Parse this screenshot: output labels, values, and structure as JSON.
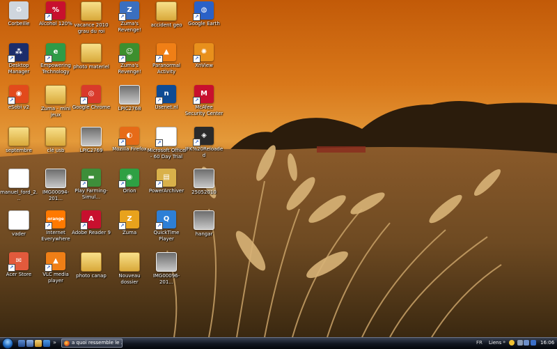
{
  "desktop": {
    "icons": [
      {
        "label": "Corbeille",
        "icon": "recycle-bin-icon",
        "shortcut": false,
        "color": "#cfd6de",
        "glyph": "♻",
        "kind": "default"
      },
      {
        "label": "Alcohol 120%",
        "icon": "alcohol-120-icon",
        "shortcut": true,
        "color": "#c8102e",
        "glyph": "%",
        "kind": "default"
      },
      {
        "label": "vacance 2010 grau du roi",
        "icon": "folder-icon",
        "shortcut": false,
        "color": "#e8c25a",
        "glyph": "",
        "kind": "folder"
      },
      {
        "label": "Zuma's Revenge!",
        "icon": "zuma-revenge-icon",
        "shortcut": true,
        "color": "#3b6fbf",
        "glyph": "Z",
        "kind": "default"
      },
      {
        "label": "accident geo",
        "icon": "folder-icon",
        "shortcut": false,
        "color": "#e8c25a",
        "glyph": "",
        "kind": "folder"
      },
      {
        "label": "Google Earth",
        "icon": "google-earth-icon",
        "shortcut": true,
        "color": "#2a61c7",
        "glyph": "◍",
        "kind": "round"
      },
      {
        "label": "Desktop Manager",
        "icon": "blackberry-desktop-manager-icon",
        "shortcut": true,
        "color": "#1b2d6b",
        "glyph": "⁂",
        "kind": "default"
      },
      {
        "label": "Empowering Technology",
        "icon": "empowering-technology-icon",
        "shortcut": true,
        "color": "#2e9b47",
        "glyph": "e",
        "kind": "round"
      },
      {
        "label": "photo materiel",
        "icon": "folder-icon",
        "shortcut": false,
        "color": "#e8c25a",
        "glyph": "",
        "kind": "folder"
      },
      {
        "label": "Zuma's Revenge!",
        "icon": "zuma-revenge-icon",
        "shortcut": true,
        "color": "#3d8f2e",
        "glyph": "☺",
        "kind": "round"
      },
      {
        "label": "Paranormal Activity",
        "icon": "vlc-cone-icon",
        "shortcut": true,
        "color": "#f07f16",
        "glyph": "▲",
        "kind": "default"
      },
      {
        "label": "XnView",
        "icon": "xnview-icon",
        "shortcut": true,
        "color": "#e8901c",
        "glyph": "✺",
        "kind": "round"
      },
      {
        "label": "eSobi v2",
        "icon": "esobi-icon",
        "shortcut": true,
        "color": "#e24a1c",
        "glyph": "◉",
        "kind": "round"
      },
      {
        "label": "Zuma - mini jeux",
        "icon": "folder-icon",
        "shortcut": false,
        "color": "#e8c25a",
        "glyph": "",
        "kind": "folder"
      },
      {
        "label": "Google Chrome",
        "icon": "google-chrome-icon",
        "shortcut": true,
        "color": "#d93a2b",
        "glyph": "◎",
        "kind": "round"
      },
      {
        "label": "LPIC2768",
        "icon": "image-file-icon",
        "shortcut": false,
        "color": "#888888",
        "glyph": "",
        "kind": "image"
      },
      {
        "label": "Usenet.nl",
        "icon": "usenet-icon",
        "shortcut": true,
        "color": "#0e4b94",
        "glyph": "n",
        "kind": "default"
      },
      {
        "label": "McAfee Security Center",
        "icon": "mcafee-icon",
        "shortcut": true,
        "color": "#c8102e",
        "glyph": "M",
        "kind": "default"
      },
      {
        "label": "septembre",
        "icon": "folder-icon",
        "shortcut": false,
        "color": "#e8c25a",
        "glyph": "",
        "kind": "folder"
      },
      {
        "label": "clé usb",
        "icon": "folder-icon",
        "shortcut": false,
        "color": "#e8c25a",
        "glyph": "",
        "kind": "folder"
      },
      {
        "label": "LPIC2769",
        "icon": "image-file-icon",
        "shortcut": false,
        "color": "#888888",
        "glyph": "",
        "kind": "image"
      },
      {
        "label": "Mozilla Firefox",
        "icon": "firefox-icon",
        "shortcut": true,
        "color": "#e66b18",
        "glyph": "◐",
        "kind": "round"
      },
      {
        "label": "Microsoft Office - 60 Day Trial",
        "icon": "microsoft-office-icon",
        "shortcut": true,
        "color": "#ffffff",
        "glyph": "▶",
        "kind": "doc"
      },
      {
        "label": "JFK%20Reloaded",
        "icon": "jfk-reloaded-icon",
        "shortcut": true,
        "color": "#2a2a2a",
        "glyph": "◈",
        "kind": "round"
      },
      {
        "label": "manuel_ford_2...",
        "icon": "pdf-file-icon",
        "shortcut": false,
        "color": "#ffffff",
        "glyph": "▦",
        "kind": "doc"
      },
      {
        "label": "IMG00094-201...",
        "icon": "image-file-icon",
        "shortcut": false,
        "color": "#888888",
        "glyph": "",
        "kind": "image"
      },
      {
        "label": "Play Farming-Simul...",
        "icon": "farming-simulator-icon",
        "shortcut": true,
        "color": "#3e8e3a",
        "glyph": "▬",
        "kind": "default"
      },
      {
        "label": "Orion",
        "icon": "orion-icon",
        "shortcut": true,
        "color": "#2ea043",
        "glyph": "◉",
        "kind": "round"
      },
      {
        "label": "PowerArchiver",
        "icon": "powerarchiver-icon",
        "shortcut": true,
        "color": "#d9b14a",
        "glyph": "▤",
        "kind": "default"
      },
      {
        "label": "25052010",
        "icon": "image-file-icon",
        "shortcut": false,
        "color": "#888888",
        "glyph": "",
        "kind": "image"
      },
      {
        "label": "vader",
        "icon": "pdf-file-icon",
        "shortcut": false,
        "color": "#ffffff",
        "glyph": "▦",
        "kind": "doc"
      },
      {
        "label": "Internet Everywhere",
        "icon": "orange-internet-icon",
        "shortcut": true,
        "color": "#ff7900",
        "glyph": "orange",
        "kind": "default"
      },
      {
        "label": "Adobe Reader 9",
        "icon": "adobe-reader-icon",
        "shortcut": true,
        "color": "#c8102e",
        "glyph": "A",
        "kind": "default"
      },
      {
        "label": "Zuma",
        "icon": "zuma-icon",
        "shortcut": true,
        "color": "#e8a21c",
        "glyph": "Z",
        "kind": "default"
      },
      {
        "label": "QuickTime Player",
        "icon": "quicktime-icon",
        "shortcut": true,
        "color": "#2d7fd6",
        "glyph": "Q",
        "kind": "round"
      },
      {
        "label": "hangar",
        "icon": "image-file-icon",
        "shortcut": false,
        "color": "#888888",
        "glyph": "",
        "kind": "image"
      },
      {
        "label": "Acer Store",
        "icon": "acer-store-icon",
        "shortcut": true,
        "color": "#e25a3c",
        "glyph": "✉",
        "kind": "default"
      },
      {
        "label": "VLC media player",
        "icon": "vlc-icon",
        "shortcut": true,
        "color": "#f07f16",
        "glyph": "▲",
        "kind": "default"
      },
      {
        "label": "photo canap",
        "icon": "folder-icon",
        "shortcut": false,
        "color": "#e8c25a",
        "glyph": "",
        "kind": "folder"
      },
      {
        "label": "Nouveau dossier",
        "icon": "folder-icon",
        "shortcut": false,
        "color": "#e8c25a",
        "glyph": "",
        "kind": "folder"
      },
      {
        "label": "IMG00096-201...",
        "icon": "image-file-icon",
        "shortcut": false,
        "color": "#888888",
        "glyph": "",
        "kind": "image"
      }
    ]
  },
  "taskbar": {
    "start_icon": "windows-start-orb-icon",
    "quick_launch_chevron": "»",
    "active_window": {
      "label": "a quoi ressemble le ...",
      "icon": "firefox-icon"
    },
    "tray": {
      "language": "FR",
      "links_label": "Liens",
      "links_chevron": "»",
      "clock": "16:06"
    }
  }
}
